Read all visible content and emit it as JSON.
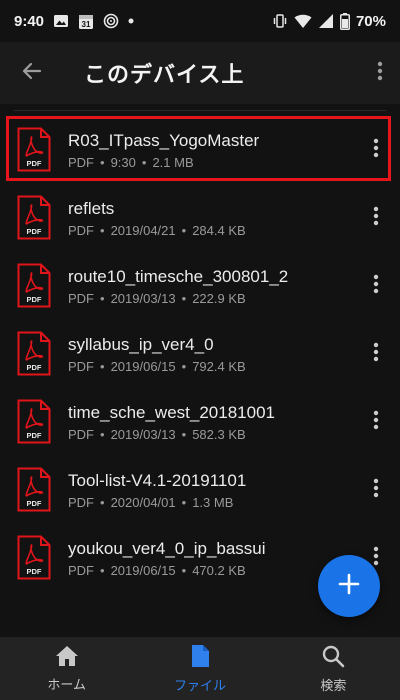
{
  "status_bar": {
    "time": "9:40",
    "calendar_day": "31",
    "battery": "70%"
  },
  "header": {
    "title": "このデバイス上"
  },
  "files": [
    {
      "name": "R03_ITpass_YogoMaster",
      "type": "PDF",
      "date": "9:30",
      "size": "2.1 MB",
      "icon_label": "PDF",
      "highlighted": true
    },
    {
      "name": "reflets",
      "type": "PDF",
      "date": "2019/04/21",
      "size": "284.4 KB",
      "icon_label": "PDF"
    },
    {
      "name": "route10_timesche_300801_2",
      "type": "PDF",
      "date": "2019/03/13",
      "size": "222.9 KB",
      "icon_label": "PDF"
    },
    {
      "name": "syllabus_ip_ver4_0",
      "type": "PDF",
      "date": "2019/06/15",
      "size": "792.4 KB",
      "icon_label": "PDF"
    },
    {
      "name": "time_sche_west_20181001",
      "type": "PDF",
      "date": "2019/03/13",
      "size": "582.3 KB",
      "icon_label": "PDF"
    },
    {
      "name": "Tool-list-V4.1-20191101",
      "type": "PDF",
      "date": "2020/04/01",
      "size": "1.3 MB",
      "icon_label": "PDF"
    },
    {
      "name": "youkou_ver4_0_ip_bassui",
      "type": "PDF",
      "date": "2019/06/15",
      "size": "470.2 KB",
      "icon_label": "PDF"
    }
  ],
  "meta_separator": "•",
  "bottom_nav": {
    "home": "ホーム",
    "files": "ファイル",
    "search": "検索"
  },
  "colors": {
    "accent": "#1b73e8",
    "pdf_red": "#e0141b",
    "highlight": "#e8141b",
    "active_nav": "#2f80ed"
  },
  "icons": {
    "back": "arrow-left-icon",
    "overflow": "more-vert-icon",
    "file": "pdf-file-icon",
    "fab": "plus-icon",
    "home": "home-icon",
    "files": "file-icon",
    "search": "search-icon"
  }
}
